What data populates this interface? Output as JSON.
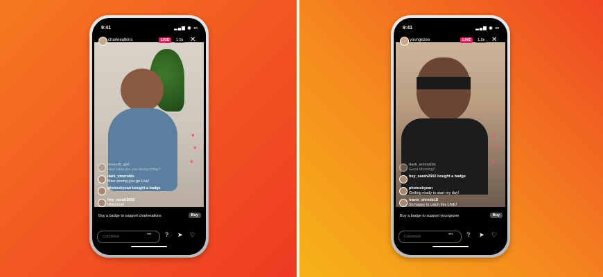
{
  "left": {
    "time": "9:41",
    "username": "charleeatkins",
    "live": "LIVE",
    "viewers": "1.5k",
    "comments": [
      {
        "user": "crossfit_girl",
        "text": "Hey! How are you doing today?",
        "faded": true
      },
      {
        "user": "dark_emeralds",
        "text": "Miss seeing you go Live!"
      },
      {
        "user": "photosbyean bought a badge",
        "text": ""
      },
      {
        "user": "hey_sarah2002",
        "text": "Welcome!"
      }
    ],
    "badge_text": "Buy a badge to support charleeatkins",
    "buy": "Buy",
    "comment_placeholder": "Comment"
  },
  "right": {
    "time": "9:41",
    "username": "youngezee",
    "live": "LIVE",
    "viewers": "1.5k",
    "comments": [
      {
        "user": "dark_emeralds",
        "text": "Good Morning!!",
        "faded": true
      },
      {
        "user": "hey_sarah2002 bought a badge",
        "text": ""
      },
      {
        "user": "photosbyean",
        "text": "Getting ready to start my day!"
      },
      {
        "user": "travis_shreds18",
        "text": "So happy to catch this LIVE!"
      }
    ],
    "badge_text": "Buy a badge to support youngezee",
    "buy": "Buy",
    "comment_placeholder": "Comment"
  },
  "colors": {
    "live": "#e21e64",
    "heart": "#ff4f7a"
  }
}
